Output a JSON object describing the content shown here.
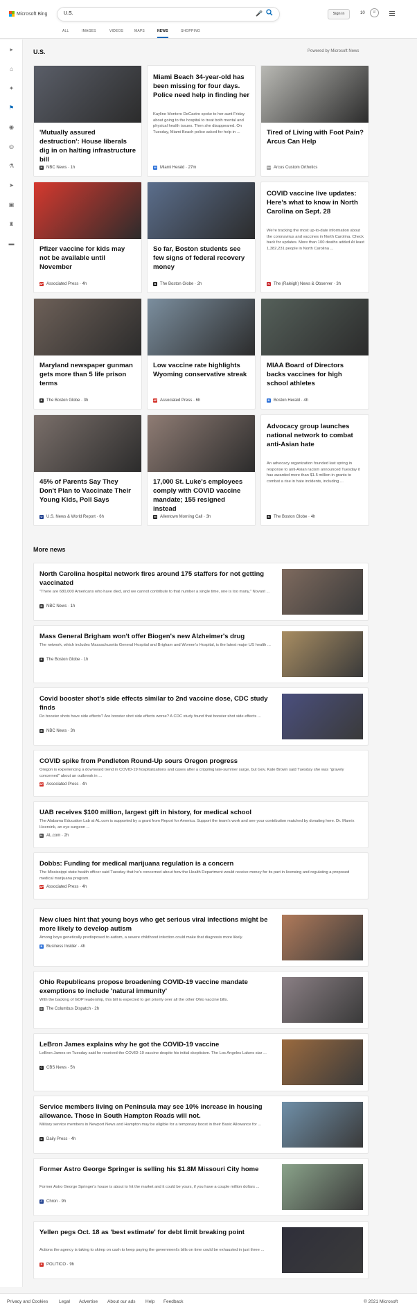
{
  "header": {
    "brand": "Microsoft Bing",
    "search_value": "U.S.",
    "sign_in": "Sign in",
    "points": "10"
  },
  "tabs": [
    "ALL",
    "IMAGES",
    "VIDEOS",
    "MAPS",
    "NEWS",
    "SHOPPING"
  ],
  "active_tab": "NEWS",
  "sidebar_icons": [
    "chevron-right-icon",
    "home-icon",
    "discover-icon",
    "flag-icon",
    "location-icon",
    "globe-icon",
    "science-icon",
    "rocket-icon",
    "entertainment-icon",
    "politics-icon",
    "money-icon"
  ],
  "section": {
    "title": "U.S.",
    "powered": "Powered by Microsoft News"
  },
  "cards": [
    {
      "title": "'Mutually assured destruction': House liberals dig in on halting infrastructure bill",
      "summary": "",
      "source": "NBC News · 1h",
      "favicon": "N",
      "favcolor": "#333333",
      "imgcolor": "#5a5e68"
    },
    {
      "title": "Miami Beach 34-year-old has been missing for four days. Police need help in finding her",
      "summary": "Kayline Montero DeCastro spoke to her aunt Friday about going to the hospital to treat both mental and physical health issues. Then she disappeared. On Tuesday, Miami Beach police asked for help in ...",
      "source": "Miami Herald · 27m",
      "favicon": "M",
      "favcolor": "#2a6fd8",
      "imgcolor": ""
    },
    {
      "title": "Tired of Living with Foot Pain? Arcus Can Help",
      "summary": "",
      "source": "Arcus Custom Orthotics",
      "favicon": "Ad",
      "favcolor": "#999999",
      "imgcolor": "#b9b9b4"
    },
    {
      "title": "Pfizer vaccine for kids may not be available until November",
      "summary": "",
      "source": "Associated Press · 4h",
      "favicon": "AP",
      "favcolor": "#d22f27",
      "imgcolor": "#d5392f"
    },
    {
      "title": "So far, Boston students see few signs of federal recovery money",
      "summary": "",
      "source": "The Boston Globe · 2h",
      "favicon": "B",
      "favcolor": "#222222",
      "imgcolor": "#5b6e8c"
    },
    {
      "title": "COVID vaccine live updates: Here's what to know in North Carolina on Sept. 28",
      "summary": "We're tracking the most up-to-date information about the coronavirus and vaccines in North Carolina. Check back for updates. More than 100 deaths added At least 1,382,231 people in North Carolina ...",
      "source": "The (Raleigh) News & Observer · 3h",
      "favicon": "N",
      "favcolor": "#c8262c",
      "imgcolor": ""
    },
    {
      "title": "Maryland newspaper gunman gets more than 5 life prison terms",
      "summary": "",
      "source": "The Boston Globe · 3h",
      "favicon": "B",
      "favcolor": "#222222",
      "imgcolor": "#6d6058"
    },
    {
      "title": "Low vaccine rate highlights Wyoming conservative streak",
      "summary": "",
      "source": "Associated Press · 6h",
      "favicon": "AP",
      "favcolor": "#d22f27",
      "imgcolor": "#7b8e9e"
    },
    {
      "title": "MIAA Board of Directors backs vaccines for high school athletes",
      "summary": "",
      "source": "Boston Herald · 4h",
      "favicon": "B",
      "favcolor": "#2a6fd8",
      "imgcolor": "#55605a"
    },
    {
      "title": "45% of Parents Say They Don't Plan to Vaccinate Their Young Kids, Poll Says",
      "summary": "",
      "source": "U.S. News & World Report · 6h",
      "favicon": "U",
      "favcolor": "#1f3f8f",
      "imgcolor": "#7a6f6a"
    },
    {
      "title": "17,000 St. Luke's employees comply with COVID vaccine mandate; 155 resigned instead",
      "summary": "",
      "source": "Allentown Morning Call · 3h",
      "favicon": "M",
      "favcolor": "#222222",
      "imgcolor": "#8f7c74"
    },
    {
      "title": "Advocacy group launches national network to combat anti-Asian hate",
      "summary": "An advocacy organization founded last spring in response to anti-Asian racism announced Tuesday it has awarded more than $1.5 million in grants to combat a rise in hate incidents, including ...",
      "source": "The Boston Globe · 4h",
      "favicon": "B",
      "favcolor": "#222222",
      "imgcolor": ""
    }
  ],
  "more_news": {
    "title": "More news",
    "items": [
      {
        "title": "North Carolina hospital network fires around 175 staffers for not getting vaccinated",
        "summary": "\"There are 680,000 Americans who have died, and we cannot contribute to that number a single time, one is too many,\" Novant ...",
        "source": "NBC News · 1h",
        "favicon": "N",
        "favcolor": "#333333",
        "imgcolor": "#7e6a5e"
      },
      {
        "title": "Mass General Brigham won't offer Biogen's new Alzheimer's drug",
        "summary": "The network, which includes Massachusetts General Hospital and Brigham and Women's Hospital, is the latest major US health ...",
        "source": "The Boston Globe · 1h",
        "favicon": "B",
        "favcolor": "#222222",
        "imgcolor": "#a88d62"
      },
      {
        "title": "Covid booster shot's side effects similar to 2nd vaccine dose, CDC study finds",
        "summary": "Do booster shots have side effects? Are booster shot side effects worse? A CDC study found that booster shot side effects ...",
        "source": "NBC News · 3h",
        "favicon": "N",
        "favcolor": "#333333",
        "imgcolor": "#4a4f7e"
      },
      {
        "title": "COVID spike from Pendleton Round-Up sours Oregon progress",
        "summary": "Oregon is experiencing a downward trend in COVID-19 hospitalizations and cases after a crippling late-summer surge, but Gov. Kate Brown said Tuesday she was \"gravely concerned\" about an outbreak in ...",
        "source": "Associated Press · 4h",
        "favicon": "AP",
        "favcolor": "#d22f27",
        "imgcolor": ""
      },
      {
        "title": "UAB receives $100 million, largest gift in history, for medical school",
        "summary": "The Alabama Education Lab at AL.com is supported by a grant from Report for America. Support the team's work and see your contribution matched by donating here. Dr. Marnix Heersink, an eye surgeon ...",
        "source": "AL.com · 2h",
        "favicon": "AL",
        "favcolor": "#444444",
        "imgcolor": ""
      },
      {
        "title": "Dobbs: Funding for medical marijuana regulation is a concern",
        "summary": "The Mississippi state health officer said Tuesday that he's concerned about how the Health Department would receive money for its part in licensing and regulating a proposed medical marijuana program.",
        "source": "Associated Press · 4h",
        "favicon": "AP",
        "favcolor": "#d22f27",
        "imgcolor": ""
      },
      {
        "title": "New clues hint that young boys who get serious viral infections might be more likely to develop autism",
        "summary": "Among boys genetically predisposed to autism, a severe childhood infection could make that diagnosis more likely.",
        "source": "Business Insider · 4h",
        "favicon": "B",
        "favcolor": "#2a6fd8",
        "imgcolor": "#b07a5a"
      },
      {
        "title": "Ohio Republicans propose broadening COVID-19 vaccine mandate exemptions to include 'natural immunity'",
        "summary": "With the backing of GOP leadership, this bill is expected to get priority over all the other Ohio vaccine bills.",
        "source": "The Columbus Dispatch · 2h",
        "favicon": "D",
        "favcolor": "#555555",
        "imgcolor": "#8a7f84"
      },
      {
        "title": "LeBron James explains why he got the COVID-19 vaccine",
        "summary": "LeBron James on Tuesday said he received the COVID-19 vaccine despite his initial skepticism. The Los Angeles Lakers star ...",
        "source": "CBS News · 5h",
        "favicon": "C",
        "favcolor": "#222222",
        "imgcolor": "#9a6a3f"
      },
      {
        "title": "Service members living on Peninsula may see 10% increase in housing allowance. Those in South Hampton Roads will not.",
        "summary": "Military service members in Newport News and Hampton may be eligible for a temporary boost in their Basic Allowance for ...",
        "source": "Daily Press · 4h",
        "favicon": "D",
        "favcolor": "#222222",
        "imgcolor": "#6f8fa8"
      },
      {
        "title": "Former Astro George Springer is selling his $1.8M Missouri City home",
        "summary": "Former Astro George Springer's house is about to hit the market and it could be yours, if you have a couple million dollars ...",
        "source": "Chron · 9h",
        "favicon": "C",
        "favcolor": "#1f3f8f",
        "imgcolor": "#8aa38a"
      },
      {
        "title": "Yellen pegs Oct. 18 as 'best estimate' for debt limit breaking point",
        "summary": "Actions the agency is taking to skimp on cash to keep paying the government's bills on time could be exhausted in just three ...",
        "source": "POLITICO · 9h",
        "favicon": "P",
        "favcolor": "#d22f27",
        "imgcolor": "#2f2f3a"
      }
    ]
  },
  "footer": {
    "links": [
      "Privacy and Cookies",
      "Legal",
      "Advertise",
      "About our ads",
      "Help",
      "Feedback"
    ],
    "copyright": "© 2021 Microsoft"
  }
}
